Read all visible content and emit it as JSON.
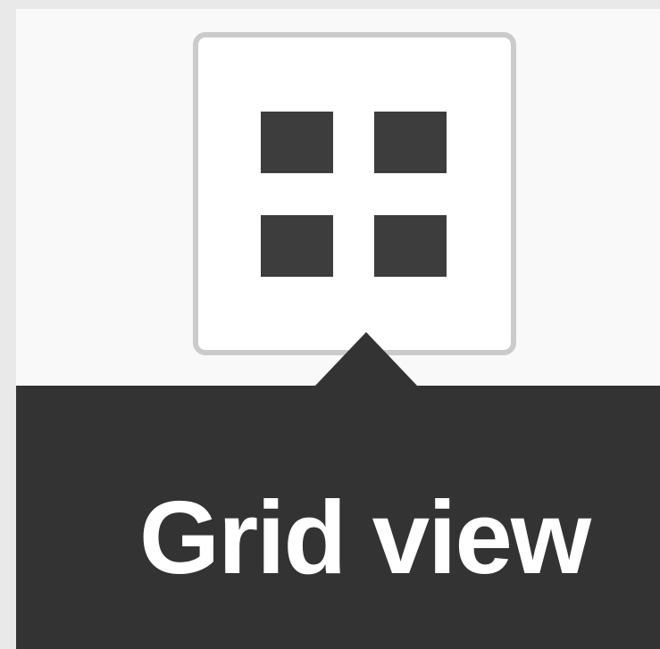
{
  "toolbar": {
    "grid_view_button": {
      "icon": "grid-icon"
    }
  },
  "tooltip": {
    "label": "Grid view"
  },
  "colors": {
    "tooltip_background": "#333333",
    "tooltip_text": "#ffffff",
    "icon": "#3d3d3d",
    "button_border": "#cbcbcb",
    "panel_background": "#f9f9f9"
  }
}
